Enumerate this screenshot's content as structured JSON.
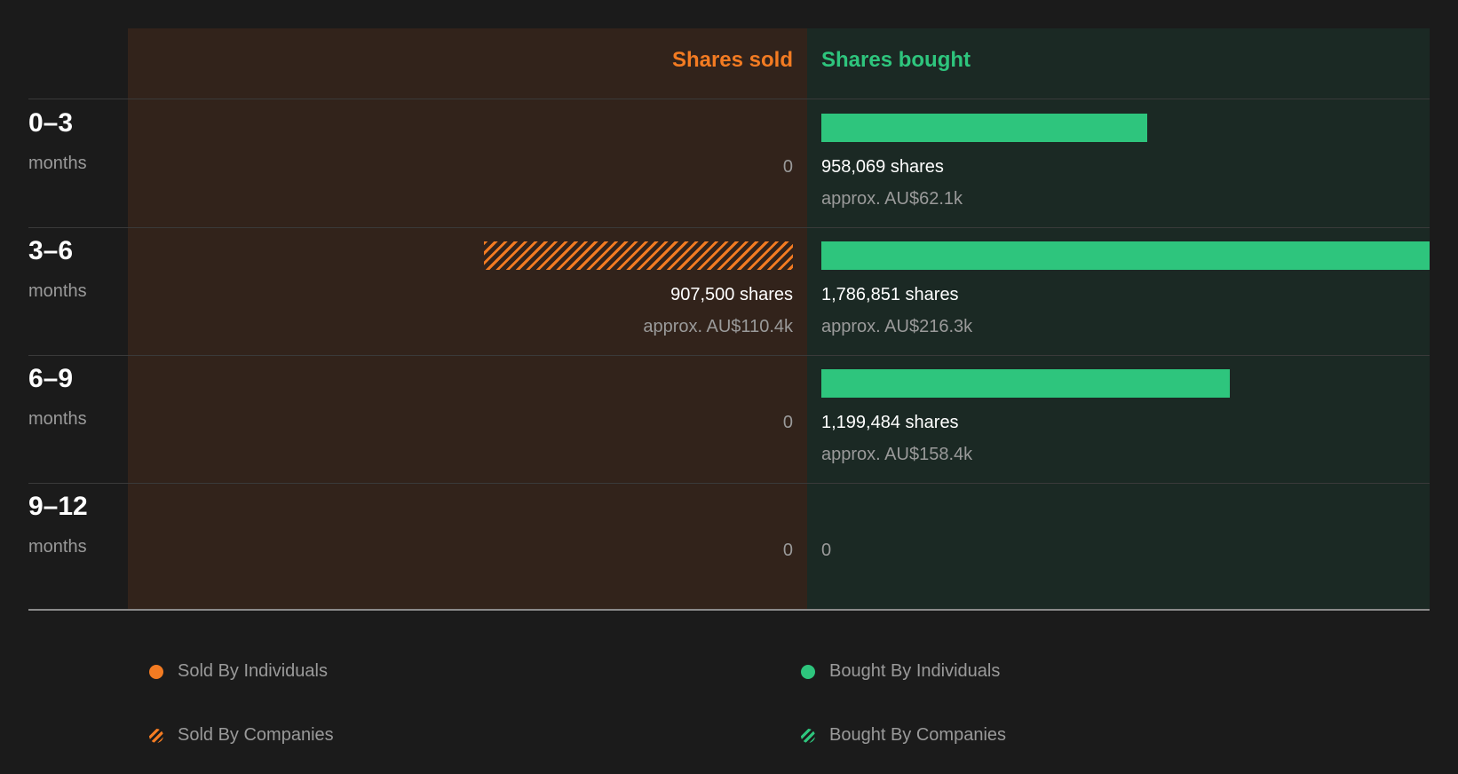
{
  "colors": {
    "sold": "#f37b22",
    "bought": "#2ec57d"
  },
  "header": {
    "sold": "Shares sold",
    "bought": "Shares bought"
  },
  "rows": [
    {
      "period": "0–3",
      "unit": "months",
      "sold_shares": "0",
      "sold_value": "",
      "bought_shares": "958,069 shares",
      "bought_value": "approx. AU$62.1k"
    },
    {
      "period": "3–6",
      "unit": "months",
      "sold_shares": "907,500 shares",
      "sold_value": "approx. AU$110.4k",
      "bought_shares": "1,786,851 shares",
      "bought_value": "approx. AU$216.3k"
    },
    {
      "period": "6–9",
      "unit": "months",
      "sold_shares": "0",
      "sold_value": "",
      "bought_shares": "1,199,484 shares",
      "bought_value": "approx. AU$158.4k"
    },
    {
      "period": "9–12",
      "unit": "months",
      "sold_shares": "0",
      "sold_value": "",
      "bought_shares": "0",
      "bought_value": ""
    }
  ],
  "legend": {
    "sold_individuals": "Sold By Individuals",
    "sold_companies": "Sold By Companies",
    "bought_individuals": "Bought By Individuals",
    "bought_companies": "Bought By Companies"
  },
  "chart_data": {
    "type": "bar",
    "categories": [
      "0–3 months",
      "3–6 months",
      "6–9 months",
      "9–12 months"
    ],
    "series": [
      {
        "name": "Sold By Individuals",
        "values": [
          0,
          0,
          0,
          0
        ]
      },
      {
        "name": "Sold By Companies",
        "values": [
          0,
          907500,
          0,
          0
        ]
      },
      {
        "name": "Bought By Individuals",
        "values": [
          958069,
          1786851,
          1199484,
          0
        ]
      },
      {
        "name": "Bought By Companies",
        "values": [
          0,
          0,
          0,
          0
        ]
      }
    ],
    "value_labels": {
      "sold": [
        "0",
        "907,500 shares",
        "0",
        "0"
      ],
      "bought": [
        "958,069 shares",
        "1,786,851 shares",
        "1,199,484 shares",
        "0"
      ]
    },
    "approx_values": {
      "sold": [
        "",
        "approx. AU$110.4k",
        "",
        ""
      ],
      "bought": [
        "approx. AU$62.1k",
        "approx. AU$216.3k",
        "approx. AU$158.4k",
        ""
      ]
    },
    "title": "",
    "xlabel": "",
    "ylabel": "",
    "legend_position": "bottom",
    "max_value": 1786851
  }
}
